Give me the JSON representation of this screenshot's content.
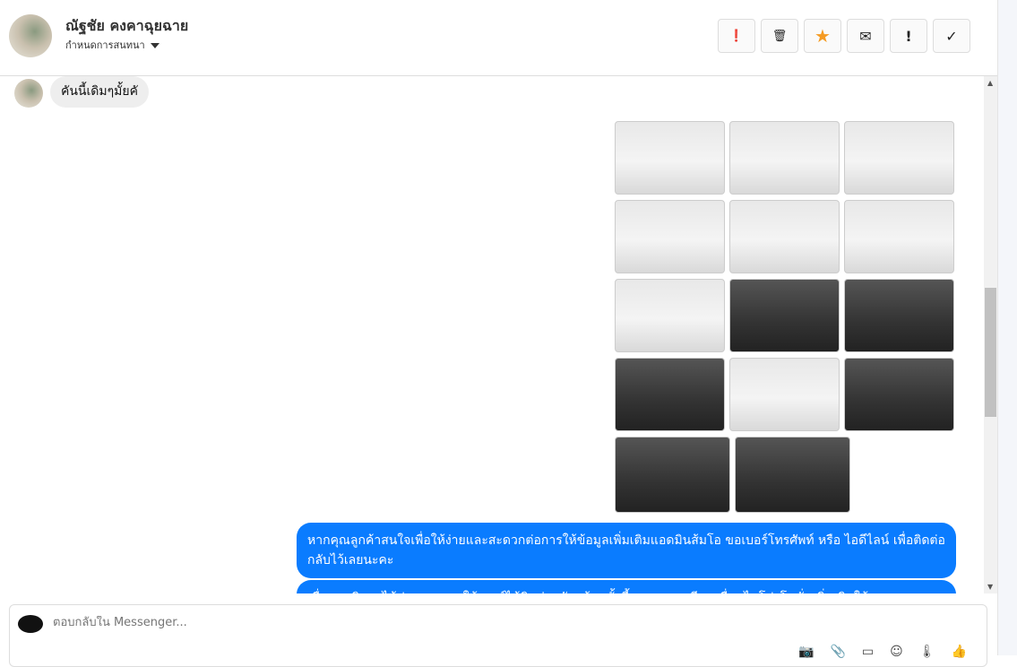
{
  "header": {
    "name": "ณัฐชัย คงคาฉุยฉาย",
    "subtitle": "กำหนดการสนทนา",
    "actions": [
      {
        "icon": "alert-circle-icon",
        "glyph": "❗"
      },
      {
        "icon": "trash-icon",
        "glyph": "🗑"
      },
      {
        "icon": "star-icon",
        "glyph": "★",
        "color": "#f59b23"
      },
      {
        "icon": "envelope-icon",
        "glyph": "✉"
      },
      {
        "icon": "exclamation-icon",
        "glyph": "!"
      },
      {
        "icon": "check-icon",
        "glyph": "✓"
      }
    ]
  },
  "messages": {
    "incoming": "คันนี้เดิมๆมั้ยคั",
    "outgoing1": "หากคุณลูกค้าสนใจเพื่อให้ง่ายและสะดวกต่อการให้ข้อมูลเพิ่มเติมแอดมินส้มโอ ขอเบอร์โทรศัพท์ หรือ ไอดีไลน์ เพื่อติดต่อกลับไว้เลยนะคะ",
    "outgoing2": "เพื่อแอดมินจะได้ประสานงานให้เซลล์ได้ติดต่อกลับพร้อมทั้งชี้แจงรายละเอียด เงื่อนไขโปรโมชั่นเพิ่มเติมให้"
  },
  "composer": {
    "placeholder": "ตอบกลับใน Messenger...",
    "tools": [
      "📷",
      "📎",
      "▭",
      "☺",
      "🌡",
      "👍"
    ]
  },
  "colors": {
    "accent": "#0a7cff"
  }
}
